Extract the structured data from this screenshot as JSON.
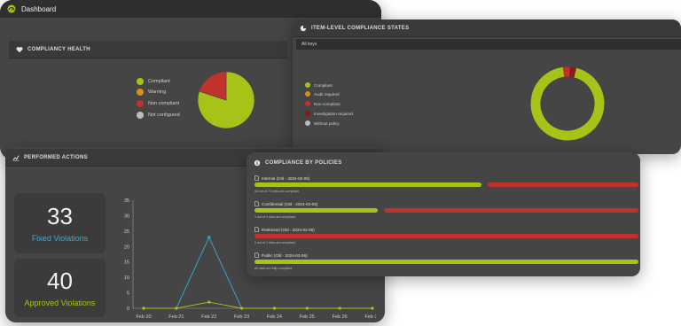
{
  "app": {
    "title": "Dashboard"
  },
  "colors": {
    "compliant": "#a5c417",
    "warning": "#d98f1a",
    "non_compliant": "#c0322c",
    "investigation": "#8b1a1a",
    "not_configured": "#bdbdbd"
  },
  "health": {
    "title": "COMPLIANCY HEALTH",
    "legend": [
      "Compliant",
      "Warning",
      "Non compliant",
      "Not configured"
    ],
    "pie": {
      "compliant": 0.8,
      "non_compliant": 0.2
    }
  },
  "item_level": {
    "title": "ITEM-LEVEL COMPLIANCE STATES",
    "filter": "All keys",
    "legend": [
      "Compliant",
      "Audit required",
      "Non-compliant",
      "Investigation required",
      "Without policy"
    ],
    "donut": {
      "compliant": 0.94,
      "non_compliant": 0.03,
      "investigation": 0.03
    }
  },
  "actions": {
    "title": "PERFORMED ACTIONS",
    "fixed": {
      "value": "33",
      "label": "Fixed Violations"
    },
    "approved": {
      "value": "40",
      "label": "Approved Violations"
    }
  },
  "chart_data": {
    "type": "line",
    "categories": [
      "Feb 20",
      "Feb 21",
      "Feb 22",
      "Feb 23",
      "Feb 24",
      "Feb 25",
      "Feb 26",
      "Feb 27"
    ],
    "ylim": [
      0,
      35
    ],
    "yticks": [
      "0",
      "5",
      "10",
      "15",
      "20",
      "25",
      "30",
      "35"
    ],
    "series": [
      {
        "color": "#3fa9d6",
        "values": [
          0,
          0,
          23,
          0,
          0,
          0,
          0,
          0
        ]
      },
      {
        "color": "#a5c417",
        "values": [
          0,
          0,
          2,
          0,
          0,
          0,
          0,
          0
        ]
      }
    ]
  },
  "policies": {
    "title": "COMPLIANCE BY POLICIES",
    "items": [
      {
        "name": "Internal (Old - 2024-02-06)",
        "sub": "44 out of 74 sites are compliant",
        "compliant": 0.6
      },
      {
        "name": "Confidential (Old - 2024-02-06)",
        "sub": "1 out of 3 sites are compliant",
        "compliant": 0.33
      },
      {
        "name": "Restricted (Old - 2024-02-06)",
        "sub": "0 out of 1 sites are compliant",
        "compliant": 0.0
      },
      {
        "name": "Public (Old - 2024-02-06)",
        "sub": "All sites are fully compliant",
        "compliant": 1.0
      }
    ]
  }
}
